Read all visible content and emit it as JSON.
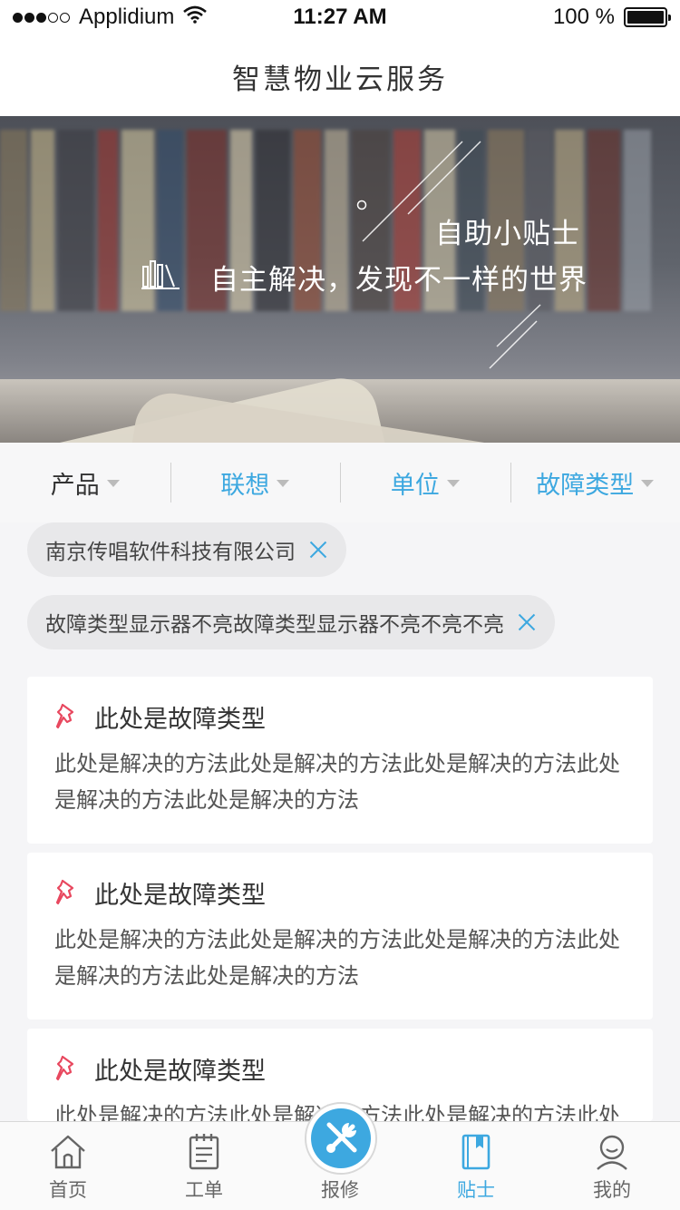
{
  "status_bar": {
    "carrier": "Applidium",
    "time": "11:27 AM",
    "battery": "100 %"
  },
  "nav": {
    "title": "智慧物业云服务"
  },
  "banner": {
    "title": "自助小贴士",
    "subtitle": "自主解决，发现不一样的世界"
  },
  "filters": [
    {
      "label": "产品"
    },
    {
      "label": "联想"
    },
    {
      "label": "单位"
    },
    {
      "label": "故障类型"
    }
  ],
  "tags": [
    {
      "text": "南京传唱软件科技有限公司"
    },
    {
      "text": "故障类型显示器不亮故障类型显示器不亮不亮不亮"
    }
  ],
  "cards": [
    {
      "title": "此处是故障类型",
      "body": "此处是解决的方法此处是解决的方法此处是解决的方法此处是解决的方法此处是解决的方法"
    },
    {
      "title": "此处是故障类型",
      "body": "此处是解决的方法此处是解决的方法此处是解决的方法此处是解决的方法此处是解决的方法"
    },
    {
      "title": "此处是故障类型",
      "body": "此处是解决的方法此处是解决的方法此处是解决的方法此处是解决的方法此处是解决的方法"
    }
  ],
  "tabbar": [
    {
      "label": "首页",
      "icon": "home-icon"
    },
    {
      "label": "工单",
      "icon": "clipboard-icon"
    },
    {
      "label": "报修",
      "icon": "tools-icon"
    },
    {
      "label": "贴士",
      "icon": "bookmark-book-icon"
    },
    {
      "label": "我的",
      "icon": "user-icon"
    }
  ],
  "colors": {
    "accent": "#3da8e0",
    "pin": "#e8485f"
  }
}
